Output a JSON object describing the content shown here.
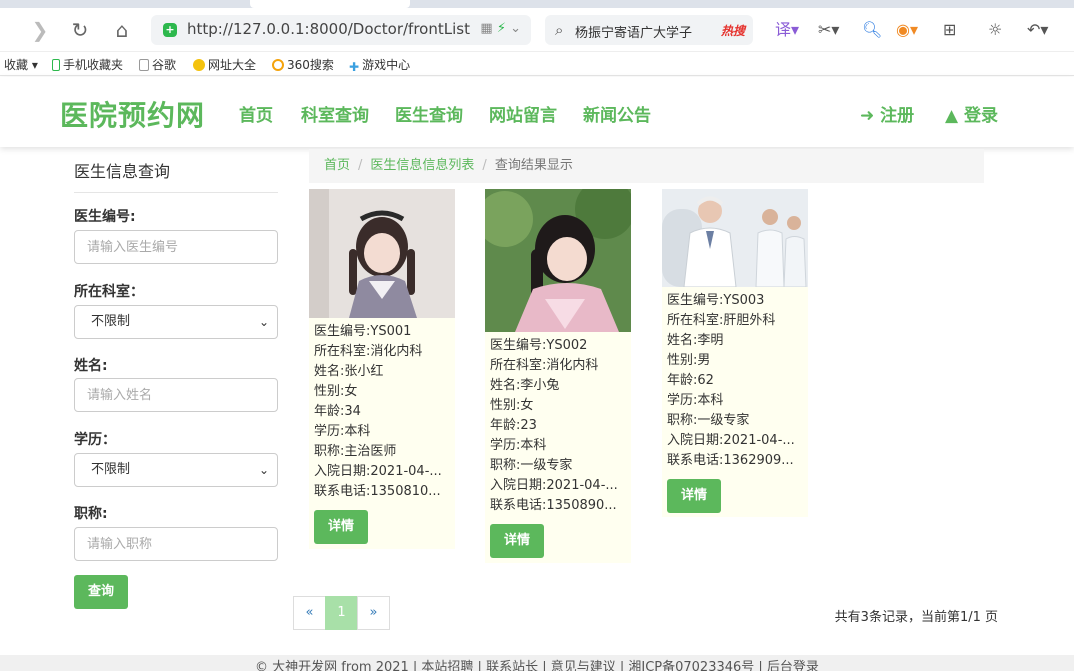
{
  "browser": {
    "url": "http://127.0.0.1:8000/Doctor/frontList",
    "search_text": "杨振宁寄语广大学子",
    "hot_badge": "热搜",
    "bookmarks": [
      "收藏",
      "手机收藏夹",
      "谷歌",
      "网址大全",
      "360搜索",
      "游戏中心"
    ]
  },
  "site": {
    "logo": "医院预约网",
    "menu": [
      "首页",
      "科室查询",
      "医生查询",
      "网站留言",
      "新闻公告"
    ],
    "register": "注册",
    "login": "登录"
  },
  "sidebar": {
    "title": "医生信息查询",
    "doctor_no_label": "医生编号:",
    "doctor_no_placeholder": "请输入医生编号",
    "dept_label": "所在科室：",
    "dept_value": "不限制",
    "name_label": "姓名:",
    "name_placeholder": "请输入姓名",
    "edu_label": "学历：",
    "edu_value": "不限制",
    "title_label": "职称:",
    "title_placeholder": "请输入职称",
    "query_button": "查询"
  },
  "breadcrumb": {
    "home": "首页",
    "list": "医生信息信息列表",
    "current": "查询结果显示"
  },
  "doctors": [
    {
      "no": "医生编号:YS001",
      "dept": "所在科室:消化内科",
      "name": "姓名:张小红",
      "sex": "性别:女",
      "age": "年龄:34",
      "edu": "学历:本科",
      "title": "职称:主治医师",
      "date": "入院日期:2021-04-...",
      "phone": "联系电话:1350810...",
      "detail": "详情"
    },
    {
      "no": "医生编号:YS002",
      "dept": "所在科室:消化内科",
      "name": "姓名:李小兔",
      "sex": "性别:女",
      "age": "年龄:23",
      "edu": "学历:本科",
      "title": "职称:一级专家",
      "date": "入院日期:2021-04-...",
      "phone": "联系电话:1350890...",
      "detail": "详情"
    },
    {
      "no": "医生编号:YS003",
      "dept": "所在科室:肝胆外科",
      "name": "姓名:李明",
      "sex": "性别:男",
      "age": "年龄:62",
      "edu": "学历:本科",
      "title": "职称:一级专家",
      "date": "入院日期:2021-04-...",
      "phone": "联系电话:1362909...",
      "detail": "详情"
    }
  ],
  "pagination": {
    "prev": "«",
    "current": "1",
    "next": "»",
    "summary": "共有3条记录，当前第1/1 页"
  },
  "footer": "© 大神开发网 from 2021 | 本站招聘 | 联系站长 | 意见与建议 | 湘ICP备07023346号 | 后台登录",
  "colors": {
    "brand_green": "#5cb85c",
    "card_bg": "#fffff0"
  }
}
